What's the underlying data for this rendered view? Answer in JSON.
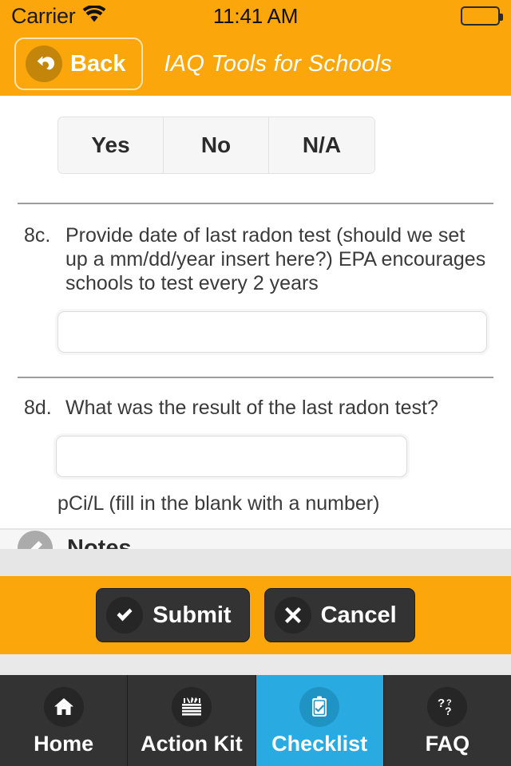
{
  "status_bar": {
    "carrier": "Carrier",
    "wifi_icon": "wifi-icon",
    "time": "11:41 AM",
    "battery_icon": "battery-full-icon"
  },
  "nav_bar": {
    "back_label": "Back",
    "back_icon": "back-arrow-icon",
    "title": "IAQ Tools for Schools"
  },
  "segmented_control": {
    "options": [
      {
        "label": "Yes"
      },
      {
        "label": "No"
      },
      {
        "label": "N/A"
      }
    ]
  },
  "questions": [
    {
      "number": "8c.",
      "text": "Provide date of last radon test (should we set up a mm/dd/year insert here?) EPA encourages schools to test every 2 years",
      "input_value": "",
      "input_placeholder": ""
    },
    {
      "number": "8d.",
      "text": "What was the result of the last radon test?",
      "input_value": "",
      "input_placeholder": "",
      "unit_note": "pCi/L (fill in the blank with a number)"
    }
  ],
  "notes_row": {
    "label": "Notes",
    "icon": "notes-pencil-icon"
  },
  "action_bar": {
    "submit_label": "Submit",
    "submit_icon": "check-icon",
    "cancel_label": "Cancel",
    "cancel_icon": "cross-icon"
  },
  "tab_bar": {
    "tabs": [
      {
        "label": "Home",
        "icon": "home-icon",
        "active": false
      },
      {
        "label": "Action Kit",
        "icon": "toolbox-icon",
        "active": false
      },
      {
        "label": "Checklist",
        "icon": "clipboard-check-icon",
        "active": true
      },
      {
        "label": "FAQ",
        "icon": "question-marks-icon",
        "active": false
      }
    ]
  },
  "colors": {
    "brand_orange": "#FBA70B",
    "active_tab_blue": "#29ABE2",
    "tab_dark": "#333333",
    "back_circle": "#C4860A"
  }
}
